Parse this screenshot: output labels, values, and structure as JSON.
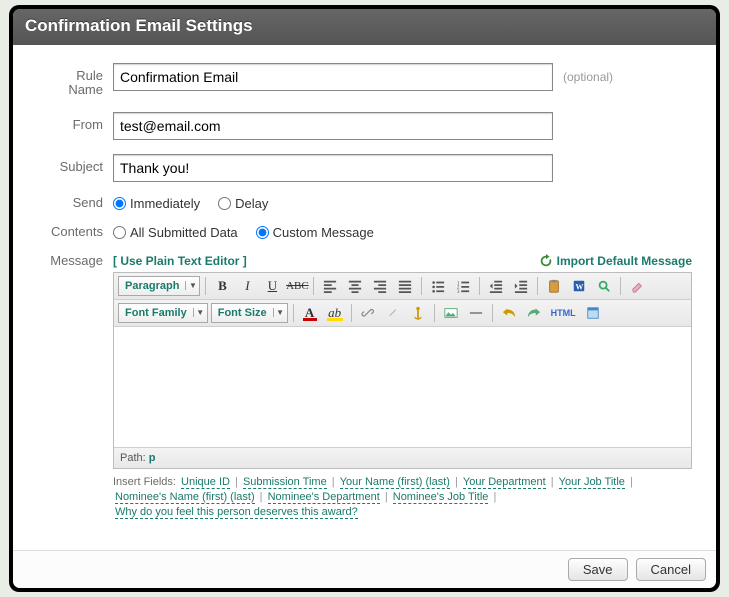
{
  "dialog": {
    "title": "Confirmation Email Settings"
  },
  "form": {
    "rule_name": {
      "label_line1": "Rule",
      "label_line2": "Name",
      "value": "Confirmation Email",
      "hint": "(optional)"
    },
    "from": {
      "label": "From",
      "value": "test@email.com"
    },
    "subject": {
      "label": "Subject",
      "value": "Thank you!"
    },
    "send": {
      "label": "Send",
      "options": {
        "immediately": "Immediately",
        "delay": "Delay"
      },
      "selected": "immediately"
    },
    "contents": {
      "label": "Contents",
      "options": {
        "all": "All Submitted Data",
        "custom": "Custom Message"
      },
      "selected": "custom"
    },
    "message": {
      "label": "Message",
      "plain_text_link": "[ Use Plain Text Editor ]",
      "import_default": "Import Default Message"
    }
  },
  "editor": {
    "paragraph": "Paragraph",
    "font_family": "Font Family",
    "font_size": "Font Size",
    "path_prefix": "Path: ",
    "path_value": "p",
    "html_btn": "HTML"
  },
  "insert_fields": {
    "heading": "Insert Fields:",
    "items": [
      "Unique ID",
      "Submission Time",
      "Your Name   (first) (last)",
      "Your Department",
      "Your Job Title",
      "Nominee's Name   (first) (last)",
      "Nominee's Department",
      "Nominee's Job Title",
      "Why do you feel this person deserves this award?"
    ]
  },
  "footer": {
    "save": "Save",
    "cancel": "Cancel"
  }
}
